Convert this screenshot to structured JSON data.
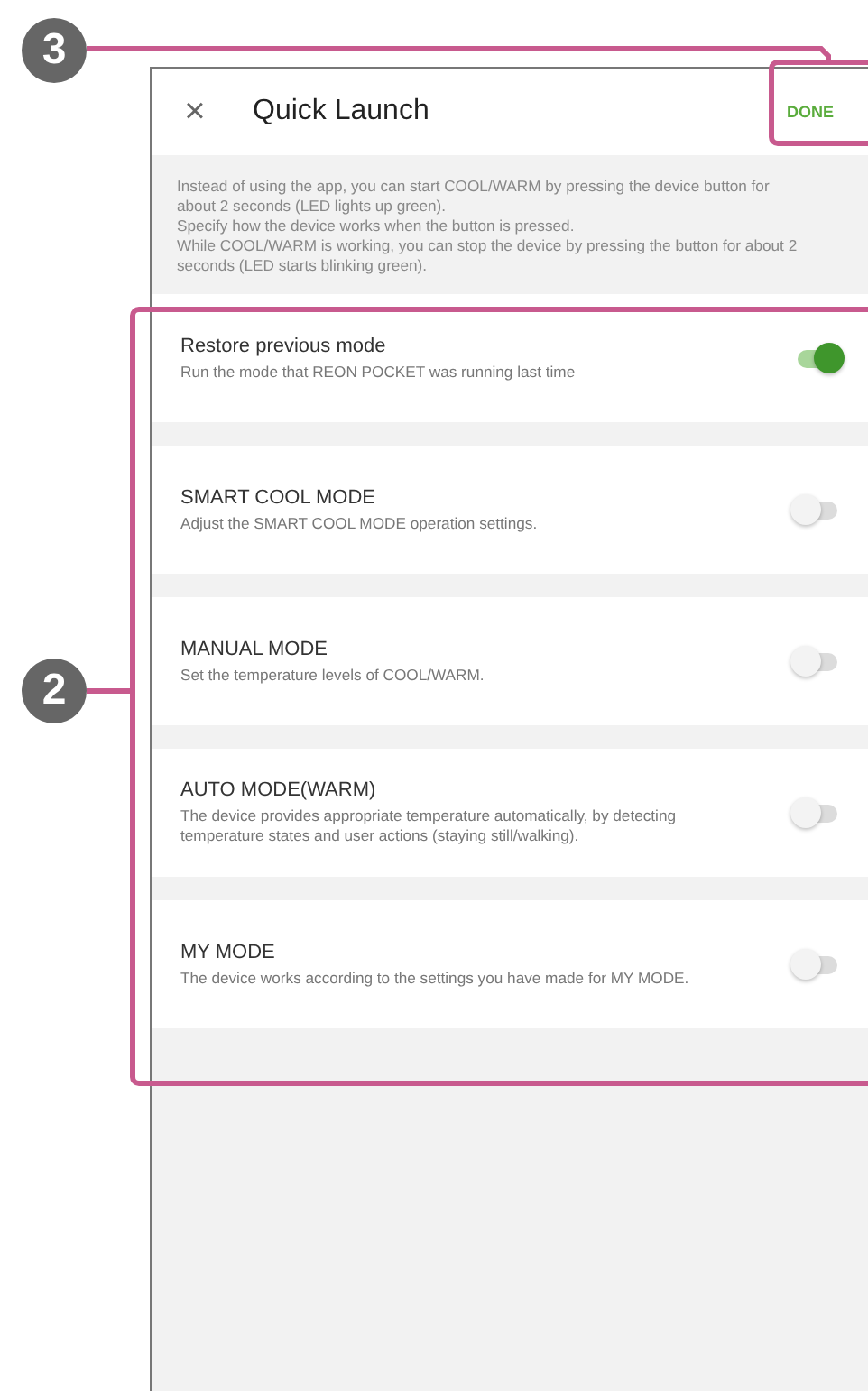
{
  "callouts": [
    {
      "label": "3"
    },
    {
      "label": "2"
    }
  ],
  "header": {
    "close": "×",
    "title": "Quick Launch",
    "done": "DONE"
  },
  "intro": [
    "Instead of using the app, you can start COOL/WARM by pressing the device button for about 2 seconds (LED lights up green).",
    "Specify how the device works when the button is pressed.",
    "While COOL/WARM is working, you can stop the device by pressing the button for about 2 seconds (LED starts blinking green)."
  ],
  "modes": [
    {
      "title": "Restore previous mode",
      "description": "Run the mode that REON POCKET was running last time",
      "on": true
    },
    {
      "title": "SMART COOL MODE",
      "description": "Adjust the SMART COOL MODE operation settings.",
      "on": false
    },
    {
      "title": "MANUAL MODE",
      "description": "Set the temperature levels of COOL/WARM.",
      "on": false
    },
    {
      "title": "AUTO MODE(WARM)",
      "description": "The device provides appropriate temperature automatically, by detecting temperature states and user actions (staying still/walking).",
      "on": false
    },
    {
      "title": "MY MODE",
      "description": "The device works according to the settings you have made for MY MODE.",
      "on": false
    }
  ]
}
